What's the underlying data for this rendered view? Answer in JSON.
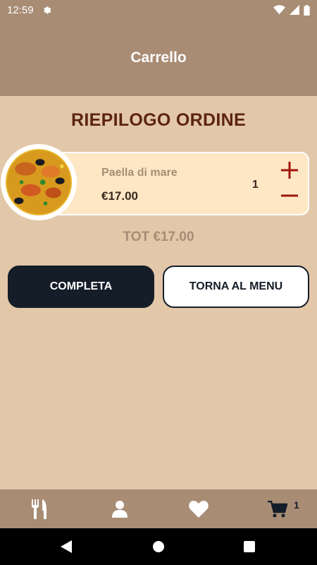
{
  "status_bar": {
    "time": "12:59",
    "icons": [
      "settings-gear-icon",
      "wifi-icon",
      "signal-icon",
      "battery-icon"
    ]
  },
  "app_bar": {
    "title": "Carrello"
  },
  "cart": {
    "summary_title": "RIEPILOGO ORDINE",
    "items": [
      {
        "name": "Paella di mare",
        "price": "€17.00",
        "quantity": "1",
        "image": "paella-dish-photo"
      }
    ],
    "total": "TOT €17.00"
  },
  "actions": {
    "complete_label": "COMPLETA",
    "back_label": "TORNA AL MENU"
  },
  "bottom_nav": {
    "items": [
      {
        "icon": "restaurant-utensils-icon"
      },
      {
        "icon": "user-icon"
      },
      {
        "icon": "heart-icon"
      },
      {
        "icon": "cart-icon",
        "badge": "1"
      }
    ]
  },
  "colors": {
    "header": "#a88c74",
    "background": "#e2c7a9",
    "card": "#fde7c5",
    "title": "#5c2410",
    "accent_red": "#a0140a",
    "dark_button": "#151d28"
  }
}
